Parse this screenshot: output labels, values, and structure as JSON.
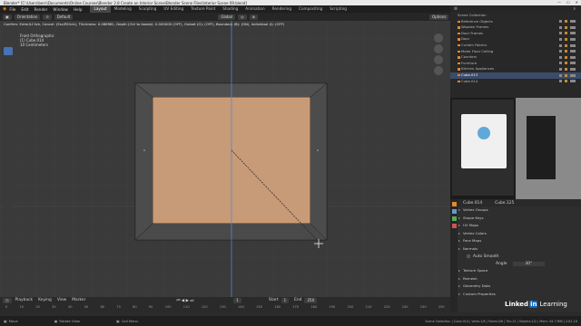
{
  "title_bar": {
    "text": "Blender* [C:\\Users\\bern\\Documents\\Online Courses\\Blender 2.8 Create an Interior Scene\\Blender Scene Files\\Interior Scene 09.blend]"
  },
  "menu": {
    "items": [
      "File",
      "Edit",
      "Render",
      "Window",
      "Help"
    ]
  },
  "workspaces": {
    "tabs": [
      "Layout",
      "Modeling",
      "Sculpting",
      "UV Editing",
      "Texture Paint",
      "Shading",
      "Animation",
      "Rendering",
      "Compositing",
      "Scripting"
    ],
    "active": "Layout",
    "scene_label": "Scene",
    "view_layer_label": "View Layer"
  },
  "viewport_header": {
    "mode": "Orientation",
    "transform": "Default",
    "pivot": "Global",
    "options": "Options"
  },
  "viewport": {
    "operator_text": "Confirm: Enter/LClick, Cancel: (Esc/RClick), Thickness: 0.066981, Depth (Ctrl to tweak): 0.000000 (OFF), Outset (O): (OFF), Boundary (B): (ON), Individual (I): (OFF)",
    "view_name": "Front Orthographic",
    "object_info": "(1) Cube.014",
    "units": "10 Centimeters"
  },
  "outliner": {
    "header": "Scene Collection",
    "items": [
      "Reference Objects",
      "Wooden Frames",
      "Door Frames",
      "Door",
      "Curtain Fabrics",
      "Metal Floor Ceiling",
      "Counters",
      "Furniture",
      "Kitchen Appliances",
      "Cube.013",
      "Cube.014"
    ],
    "selected_index": 9
  },
  "properties": {
    "object_name": "Cube.014",
    "mesh_name": "Cube.125",
    "sections": [
      "Vertex Groups",
      "Shape Keys",
      "UV Maps",
      "Vertex Colors",
      "Face Maps",
      "Normals"
    ],
    "auto_smooth_label": "Auto Smooth",
    "angle_label": "Angle",
    "angle_value": "30°",
    "more_sections": [
      "Texture Space",
      "Remesh",
      "Geometry Data",
      "Custom Properties"
    ]
  },
  "timeline": {
    "menus": [
      "Playback",
      "Keying",
      "View",
      "Marker"
    ],
    "current_frame": "1",
    "start_label": "Start",
    "start_value": "1",
    "end_label": "End",
    "end_value": "250",
    "ticks": [
      "0",
      "10",
      "20",
      "30",
      "40",
      "50",
      "60",
      "70",
      "80",
      "90",
      "100",
      "110",
      "120",
      "130",
      "140",
      "150",
      "160",
      "170",
      "180",
      "190",
      "200",
      "210",
      "220",
      "230",
      "240",
      "250"
    ]
  },
  "status_bar": {
    "left": [
      "Move",
      "Rotate View",
      "Call Menu"
    ],
    "right": "Scene Collection | Cube.014 | Verts:1/8 | Faces:0/6 | Tris:12 | Objects:1/2 | Mem: 34.7 MiB | 2.81.16"
  },
  "webcam": {
    "linkedin_text": "Linked",
    "linkedin_in": "in",
    "learning_text": "Learning"
  },
  "colors": {
    "accent": "#4772b3",
    "plane": "#c79a78",
    "linkedin_blue": "#0a66c2"
  }
}
